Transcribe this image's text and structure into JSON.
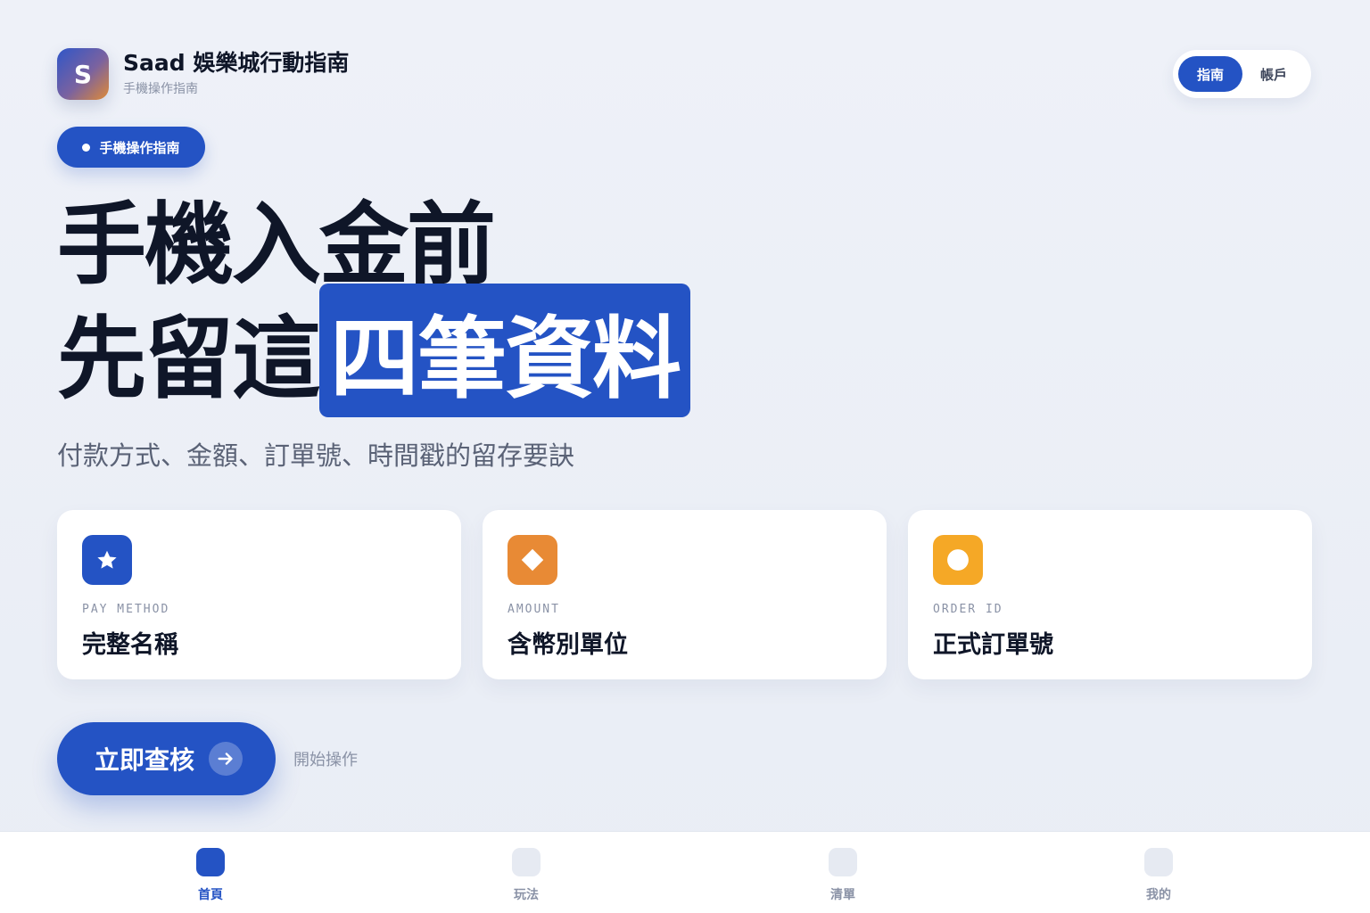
{
  "brand": {
    "logo_letter": "S",
    "title": "Saad 娛樂城行動指南",
    "subtitle": "手機操作指南"
  },
  "segmented": {
    "active": "指南",
    "other": "帳戶"
  },
  "badge": {
    "label": "手機操作指南"
  },
  "hero": {
    "line1": "手機入金前",
    "line2_plain": "先留這",
    "line2_highlight": "四筆資料",
    "subtitle": "付款方式、金額、訂單號、時間戳的留存要訣"
  },
  "cards": [
    {
      "icon": "star-icon",
      "label": "PAY METHOD",
      "value": "完整名稱",
      "color": "#2453c4"
    },
    {
      "icon": "diamond-icon",
      "label": "AMOUNT",
      "value": "含幣別單位",
      "color": "#e88a35"
    },
    {
      "icon": "circle-icon",
      "label": "ORDER ID",
      "value": "正式訂單號",
      "color": "#f5a826"
    }
  ],
  "cta": {
    "label": "立即查核",
    "hint": "開始操作"
  },
  "nav": [
    {
      "label": "首頁",
      "active": true
    },
    {
      "label": "玩法",
      "active": false
    },
    {
      "label": "清單",
      "active": false
    },
    {
      "label": "我的",
      "active": false
    }
  ]
}
